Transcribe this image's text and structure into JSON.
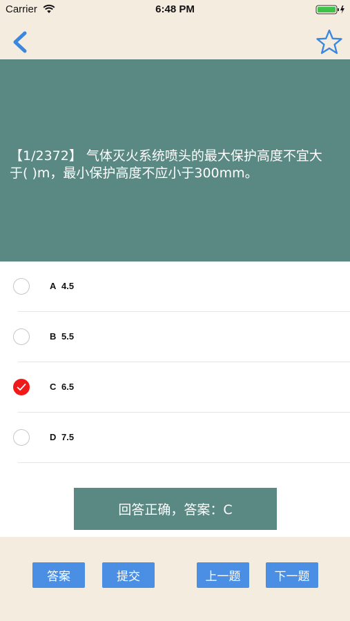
{
  "status_bar": {
    "carrier": "Carrier",
    "time": "6:48 PM"
  },
  "nav": {
    "back_icon": "chevron-left-icon",
    "favorite_icon": "star-outline-icon"
  },
  "question": {
    "text": "【1/2372】  气体灭火系统喷头的最大保护高度不宜大于( )m，最小保护高度不应小于300mm。"
  },
  "options": [
    {
      "letter": "A",
      "value": "4.5",
      "selected": false
    },
    {
      "letter": "B",
      "value": "5.5",
      "selected": false
    },
    {
      "letter": "C",
      "value": "6.5",
      "selected": true
    },
    {
      "letter": "D",
      "value": "7.5",
      "selected": false
    }
  ],
  "result": {
    "text": "回答正确，答案：C"
  },
  "buttons": {
    "answer": "答案",
    "submit": "提交",
    "prev": "上一题",
    "next": "下一题"
  },
  "colors": {
    "accent": "#4a8fe3",
    "panel": "#5a8882",
    "background": "#f5ece0",
    "selected": "#f01a1a"
  }
}
